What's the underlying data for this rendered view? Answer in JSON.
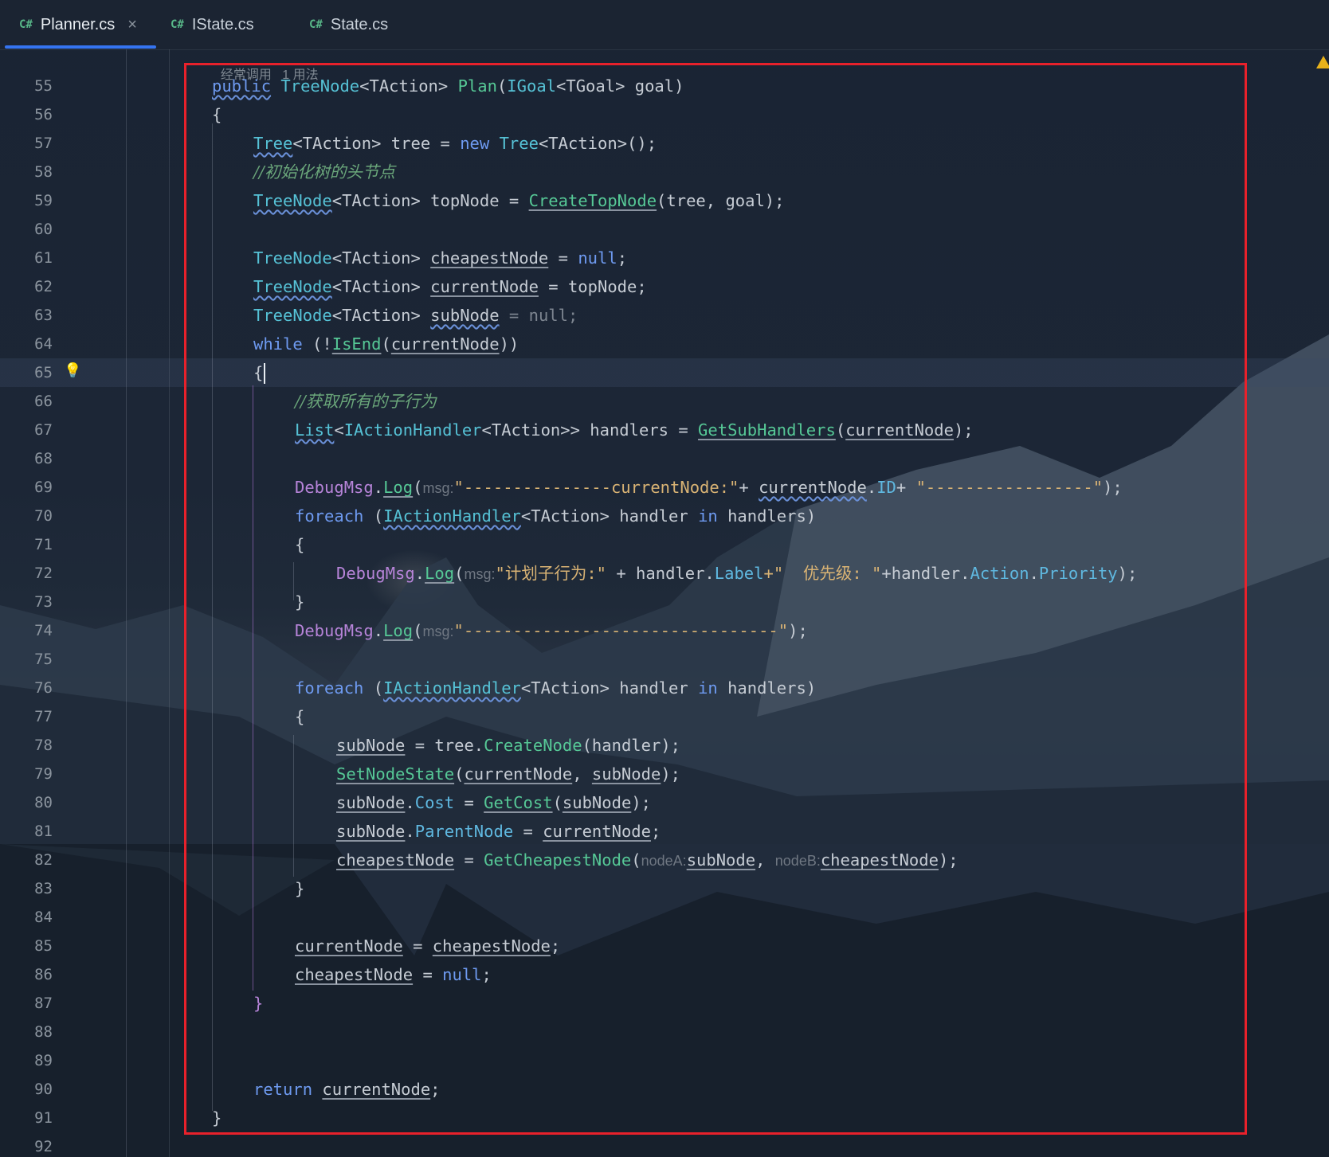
{
  "tabs": [
    {
      "lang": "C#",
      "label": "Planner.cs",
      "close": "×",
      "active": true
    },
    {
      "lang": "C#",
      "label": "IState.cs",
      "active": false
    },
    {
      "lang": "C#",
      "label": "State.cs",
      "active": false
    }
  ],
  "inlay": {
    "usage_hint": "经常调用",
    "usages": "1 用法"
  },
  "line_numbers": [
    "55",
    "56",
    "57",
    "58",
    "59",
    "60",
    "61",
    "62",
    "63",
    "64",
    "65",
    "66",
    "67",
    "68",
    "69",
    "70",
    "71",
    "72",
    "73",
    "74",
    "75",
    "76",
    "77",
    "78",
    "79",
    "80",
    "81",
    "82",
    "83",
    "84",
    "85",
    "86",
    "87",
    "88",
    "89",
    "90",
    "91",
    "92"
  ],
  "code": {
    "l55": {
      "a": "public",
      "b": "TreeNode",
      "c": "<TAction> ",
      "d": "Plan",
      "e": "(",
      "f": "IGoal",
      "g": "<TGoal> goal)"
    },
    "l56": "{",
    "l57": {
      "a": "Tree",
      "b": "<TAction> tree = ",
      "c": "new",
      "d": " ",
      "e": "Tree",
      "f": "<TAction>();"
    },
    "l58": "//初始化树的头节点",
    "l59": {
      "a": "TreeNode",
      "b": "<TAction> topNode = ",
      "c": "CreateTopNode",
      "d": "(tree, goal);"
    },
    "l61": {
      "a": "TreeNode",
      "b": "<TAction> ",
      "c": "cheapestNode",
      "d": " = ",
      "e": "null",
      "f": ";"
    },
    "l62": {
      "a": "TreeNode",
      "b": "<TAction> ",
      "c": "currentNode",
      "d": " = topNode;"
    },
    "l63": {
      "a": "TreeNode",
      "b": "<TAction> ",
      "c": "subNode",
      "d": " = null;"
    },
    "l64": {
      "a": "while",
      "b": " (!",
      "c": "IsEnd",
      "d": "(",
      "e": "currentNode",
      "f": "))"
    },
    "l65": "{",
    "l66": "//获取所有的子行为",
    "l67": {
      "a": "List",
      "b": "<",
      "c": "IActionHandler",
      "d": "<TAction>> handlers = ",
      "e": "GetSubHandlers",
      "f": "(",
      "g": "currentNode",
      "h": ");"
    },
    "l69": {
      "a": "DebugMsg",
      "b": ".",
      "c": "Log",
      "d": "(",
      "h": "msg:",
      "e": "\"---------------currentNode:\"",
      "f": "+ ",
      "g": "currentNode",
      "i": ".",
      "j": "ID",
      "k": "+ ",
      "l": "\"-----------------\"",
      "m": ");"
    },
    "l70": {
      "a": "foreach",
      "b": " (",
      "c": "IActionHandler",
      "d": "<TAction> handler ",
      "e": "in",
      "f": " handlers)"
    },
    "l71": "{",
    "l72": {
      "a": "DebugMsg",
      "b": ".",
      "c": "Log",
      "d": "(",
      "h": "msg:",
      "e": "\"计划子行为:\"",
      "f": " + handler.",
      "g": "Label",
      "i": "+\"  优先级: \"",
      "j": "+handler.",
      "k": "Action",
      "l": ".",
      "m": "Priority",
      "n": ");"
    },
    "l73": "}",
    "l74": {
      "a": "DebugMsg",
      "b": ".",
      "c": "Log",
      "d": "(",
      "h": "msg:",
      "e": "\"--------------------------------\"",
      "f": ");"
    },
    "l76": {
      "a": "foreach",
      "b": " (",
      "c": "IActionHandler",
      "d": "<TAction> handler ",
      "e": "in",
      "f": " handlers)"
    },
    "l77": "{",
    "l78": {
      "a": "subNode",
      "b": " = tree.",
      "c": "CreateNode",
      "d": "(handler);"
    },
    "l79": {
      "a": "SetNodeState",
      "b": "(",
      "c": "currentNode",
      "d": ", ",
      "e": "subNode",
      "f": ");"
    },
    "l80": {
      "a": "subNode",
      "b": ".",
      "c": "Cost",
      "d": " = ",
      "e": "GetCost",
      "f": "(",
      "g": "subNode",
      "h": ");"
    },
    "l81": {
      "a": "subNode",
      "b": ".",
      "c": "ParentNode",
      "d": " = ",
      "e": "currentNode",
      "f": ";"
    },
    "l82": {
      "a": "cheapestNode",
      "b": " = ",
      "c": "GetCheapestNode",
      "d": "(",
      "h1": "nodeA:",
      "e": "subNode",
      "f": ", ",
      "h2": "nodeB:",
      "g": "cheapestNode",
      "i": ");"
    },
    "l83": "}",
    "l85": {
      "a": "currentNode",
      "b": " = ",
      "c": "cheapestNode",
      "d": ";"
    },
    "l86": {
      "a": "cheapestNode",
      "b": " = ",
      "c": "null",
      "d": ";"
    },
    "l87": "}",
    "l90": {
      "a": "return",
      "b": " ",
      "c": "currentNode",
      "d": ";"
    },
    "l91": "}"
  },
  "colors": {
    "annotation_box": "#e8212b",
    "tab_underline": "#3574f0",
    "csharp_badge": "#58b889"
  },
  "icons": [
    "lightbulb-icon",
    "warning-icon",
    "close-icon",
    "csharp-file-icon"
  ]
}
